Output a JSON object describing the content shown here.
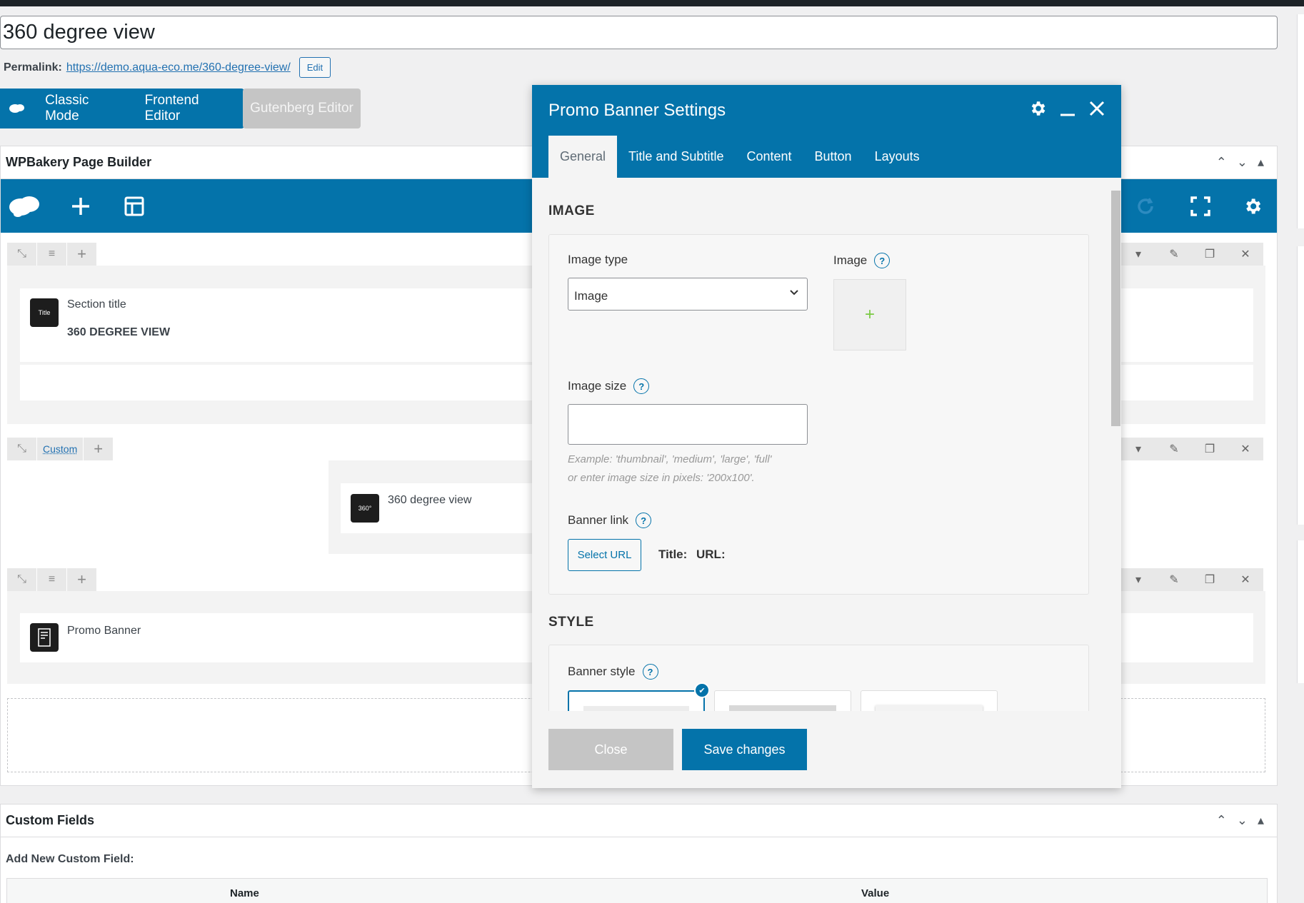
{
  "post": {
    "title": "360 degree view",
    "permalink_label": "Permalink:",
    "permalink_url": "https://demo.aqua-eco.me/360-degree-view/",
    "edit_label": "Edit"
  },
  "modes": {
    "classic": "Classic Mode",
    "frontend": "Frontend Editor",
    "gutenberg": "Gutenberg Editor"
  },
  "builder": {
    "title": "WPBakery Page Builder",
    "rows": [
      {
        "elements": [
          {
            "icon_text": "Title",
            "name": "Section title",
            "detail": "360 DEGREE VIEW"
          }
        ]
      },
      {
        "layout_link": "Custom",
        "elements": [
          {
            "icon_text": "360°",
            "name": "360 degree view"
          }
        ]
      },
      {
        "elements": [
          {
            "icon_text": "",
            "name": "Promo Banner"
          }
        ]
      }
    ]
  },
  "custom_fields": {
    "title": "Custom Fields",
    "add_label": "Add New Custom Field:",
    "col_name": "Name",
    "col_value": "Value"
  },
  "modal": {
    "title": "Promo Banner Settings",
    "tabs": [
      "General",
      "Title and Subtitle",
      "Content",
      "Button",
      "Layouts"
    ],
    "active_tab": "General",
    "image_section": "IMAGE",
    "image_type_label": "Image type",
    "image_type_value": "Image",
    "image_label": "Image",
    "image_size_label": "Image size",
    "image_size_value": "",
    "image_size_hint_1": "Example: 'thumbnail', 'medium', 'large', 'full'",
    "image_size_hint_2": "or enter image size in pixels: '200x100'.",
    "banner_link_label": "Banner link",
    "select_url": "Select URL",
    "title_label": "Title:",
    "url_label": "URL:",
    "style_section": "STYLE",
    "banner_style_label": "Banner style",
    "close_label": "Close",
    "save_label": "Save changes",
    "help_glyph": "?"
  },
  "colors": {
    "brand": "#0473aa",
    "link": "#2271b1",
    "disabled": "#c5c5c5",
    "add_plus": "#7ac943"
  }
}
